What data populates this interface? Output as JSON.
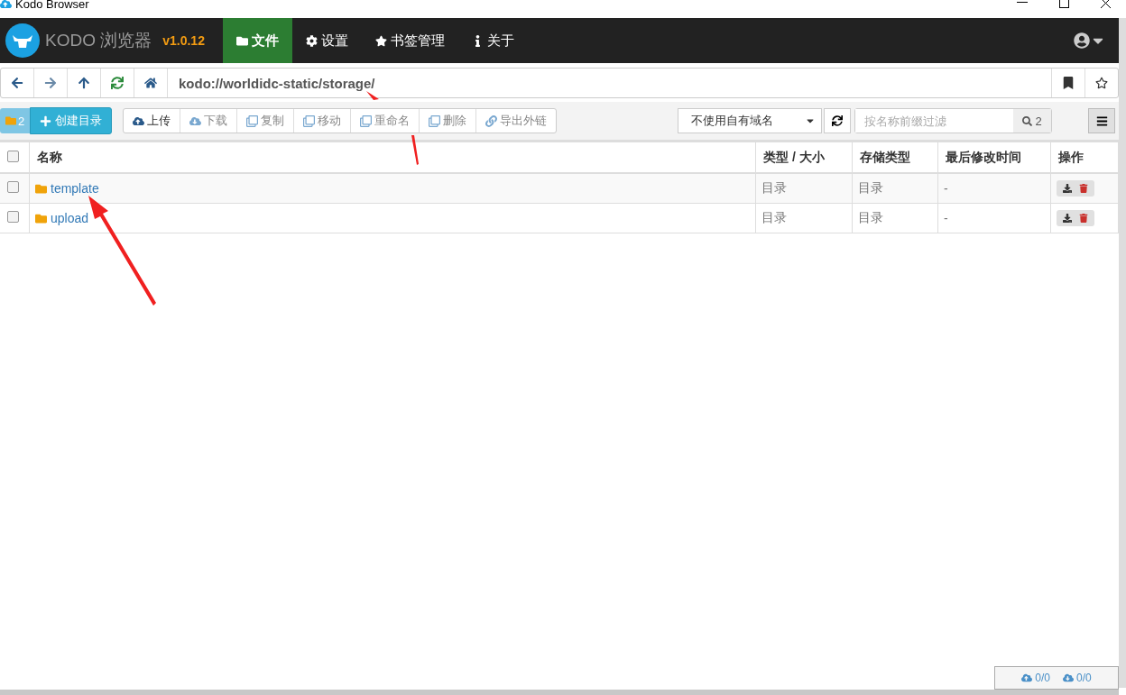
{
  "window": {
    "title": "Kodo Browser"
  },
  "navbar": {
    "brand": "KODO 浏览器",
    "version": "v1.0.12",
    "tabs": [
      {
        "kind": "files",
        "label": "文件",
        "selected": true
      },
      {
        "kind": "settings",
        "label": "设置",
        "selected": false
      },
      {
        "kind": "bookmarks",
        "label": "书签管理",
        "selected": false
      },
      {
        "kind": "about",
        "label": "关于",
        "selected": false
      }
    ]
  },
  "address_bar": {
    "value": "kodo://worldidc-static/storage/"
  },
  "toolbar": {
    "folder_count": "2",
    "create_button": "创建目录",
    "actions": [
      {
        "kind": "upload",
        "label": "上传",
        "disabled": false
      },
      {
        "kind": "download",
        "label": "下载",
        "disabled": true
      },
      {
        "kind": "copy",
        "label": "复制",
        "disabled": true
      },
      {
        "kind": "copy",
        "label": "移动",
        "disabled": true
      },
      {
        "kind": "copy",
        "label": "重命名",
        "disabled": true
      },
      {
        "kind": "copy",
        "label": "删除",
        "disabled": true
      },
      {
        "kind": "link",
        "label": "导出外链",
        "disabled": true
      }
    ],
    "domain_select": {
      "value": "不使用自有域名"
    },
    "filter": {
      "placeholder": "按名称前缀过滤",
      "count": "2"
    }
  },
  "table": {
    "select_all": {
      "checked": false
    },
    "columns": [
      "名称",
      "类型 / 大小",
      "存储类型",
      "最后修改时间",
      "操作"
    ],
    "rows": [
      {
        "checked": false,
        "name": "template",
        "type": "目录",
        "storage": "目录",
        "modified": "-"
      },
      {
        "checked": false,
        "name": "upload",
        "type": "目录",
        "storage": "目录",
        "modified": "-"
      }
    ]
  },
  "status_bar": {
    "upload": "0/0",
    "download": "0/0"
  }
}
